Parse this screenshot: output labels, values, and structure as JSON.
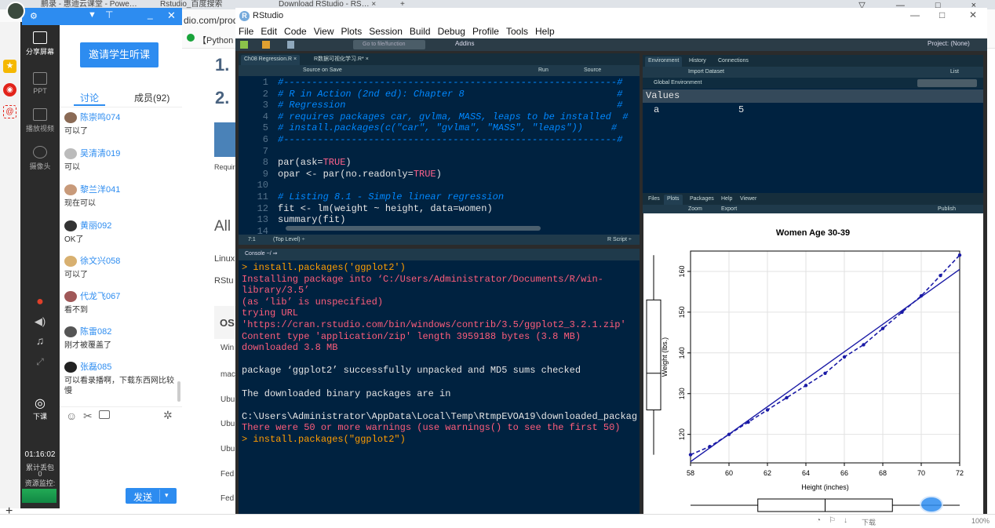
{
  "browser": {
    "tabs": [
      "鹏录 - 惠迪云课堂 - Powe…",
      "Rstudio_百度搜索",
      "Download RStudio - RS… ×",
      "+"
    ],
    "address_partial": "dio.com/prod",
    "bookmark": "【Python",
    "win_controls": "▽ — □ ×"
  },
  "webpage": {
    "heading1": "1.",
    "heading2": "2.",
    "requir": "Requir",
    "all": "All",
    "linux": "Linux",
    "rstud": "RStu",
    "os": "OS",
    "rows": [
      "Win",
      "mac",
      "Ubu",
      "Ubu",
      "Ubu",
      "Fed",
      "Fed"
    ]
  },
  "sidebar": {
    "share": "分享屏幕",
    "ppt": "PPT",
    "video": "播放视频",
    "camera": "摄像头",
    "end": "下课",
    "time": "01:16:02",
    "red_packet": "累计丢包",
    "red_count": "0",
    "monitor": "资源监控:"
  },
  "chat": {
    "invite_btn": "邀请学生听课",
    "tab_discuss": "讨论",
    "tab_members": "成员(92)",
    "messages": [
      {
        "name": "陈崇鸣074",
        "text": "可以了"
      },
      {
        "name": "吴清清019",
        "text": "可以"
      },
      {
        "name": "黎兰洋041",
        "text": "现在可以"
      },
      {
        "name": "黄丽092",
        "text": "OK了"
      },
      {
        "name": "徐文兴058",
        "text": "可以了"
      },
      {
        "name": "代龙飞067",
        "text": "看不到"
      },
      {
        "name": "陈雷082",
        "text": "刚才被覆盖了"
      },
      {
        "name": "张磊085",
        "text": "可以看录播啊，下载东西网比较慢"
      }
    ],
    "send": "发送",
    "send_arrow": "▾"
  },
  "rstudio": {
    "title": "RStudio",
    "menu": [
      "File",
      "Edit",
      "Code",
      "View",
      "Plots",
      "Session",
      "Build",
      "Debug",
      "Profile",
      "Tools",
      "Help"
    ],
    "go_to": "Go to file/function",
    "addins": "Addins",
    "project": "Project: (None)",
    "editor_tabs": [
      "Ch08 Regression.R ×",
      "R数据可视化学习.R* ×"
    ],
    "editor_tool": {
      "source_on_save": "Source on Save",
      "run": "Run",
      "source": "Source"
    },
    "code_lines": [
      {
        "n": "1",
        "t": "#-----------------------------------------------------------#",
        "c": "cm"
      },
      {
        "n": "2",
        "t": "# R in Action (2nd ed): Chapter 8                           #",
        "c": "cm"
      },
      {
        "n": "3",
        "t": "# Regression                                                #",
        "c": "cm"
      },
      {
        "n": "4",
        "t": "# requires packages car, gvlma, MASS, leaps to be installed  #",
        "c": "cm"
      },
      {
        "n": "5",
        "t": "# install.packages(c(\"car\", \"gvlma\", \"MASS\", \"leaps\"))     #",
        "c": "cm"
      },
      {
        "n": "6",
        "t": "#-----------------------------------------------------------#",
        "c": "cm"
      },
      {
        "n": "7",
        "t": "",
        "c": "tx"
      },
      {
        "n": "8",
        "t": "par(ask=TRUE)",
        "c": "tx"
      },
      {
        "n": "9",
        "t": "opar <- par(no.readonly=TRUE)",
        "c": "tx"
      },
      {
        "n": "10",
        "t": "",
        "c": "tx"
      },
      {
        "n": "11",
        "t": "# Listing 8.1 - Simple linear regression",
        "c": "cm"
      },
      {
        "n": "12",
        "t": "fit <- lm(weight ~ height, data=women)",
        "c": "tx"
      },
      {
        "n": "13",
        "t": "summary(fit)",
        "c": "tx"
      },
      {
        "n": "14",
        "t": "",
        "c": "tx"
      }
    ],
    "editor_status": {
      "pos": "7:1",
      "level": "(Top Level) ÷",
      "type": "R Script ÷"
    },
    "console_tab": "Console ~/ ⇒",
    "console_lines": [
      {
        "t": "> install.packages('ggplot2')",
        "c": "p"
      },
      {
        "t": "Installing package into ‘C:/Users/Administrator/Documents/R/win-library/3.5’",
        "c": "r"
      },
      {
        "t": "(as ‘lib’ is unspecified)",
        "c": "r"
      },
      {
        "t": "trying URL 'https://cran.rstudio.com/bin/windows/contrib/3.5/ggplot2_3.2.1.zip'",
        "c": "r"
      },
      {
        "t": "Content type 'application/zip' length 3959188 bytes (3.8 MB)",
        "c": "r"
      },
      {
        "t": "downloaded 3.8 MB",
        "c": "r"
      },
      {
        "t": " ",
        "c": ""
      },
      {
        "t": "package ‘ggplot2’ successfully unpacked and MD5 sums checked",
        "c": ""
      },
      {
        "t": " ",
        "c": ""
      },
      {
        "t": "The downloaded binary packages are in",
        "c": ""
      },
      {
        "t": "        C:\\Users\\Administrator\\AppData\\Local\\Temp\\RtmpEVOA19\\downloaded_packages",
        "c": ""
      },
      {
        "t": "There were 50 or more warnings (use warnings() to see the first 50)",
        "c": "r"
      },
      {
        "t": "> install.packages(\"ggplot2\")",
        "c": "p"
      }
    ],
    "env_tabs": [
      "Environment",
      "History",
      "Connections"
    ],
    "env_tool": {
      "import": "Import Dataset",
      "list": "List",
      "global": "Global Environment"
    },
    "env_section": "Values",
    "env_var": {
      "name": "a",
      "value": "5"
    },
    "files_tabs": [
      "Files",
      "Plots",
      "Packages",
      "Help",
      "Viewer"
    ],
    "plots_tool": {
      "zoom": "Zoom",
      "export": "Export",
      "publish": "Publish"
    }
  },
  "chart_data": {
    "type": "scatter",
    "title": "Women Age 30-39",
    "xlabel": "Height (inches)",
    "ylabel": "Weight (lbs.)",
    "xlim": [
      58,
      72
    ],
    "ylim": [
      113,
      165
    ],
    "xticks": [
      "58",
      "60",
      "62",
      "64",
      "66",
      "68",
      "70",
      "72"
    ],
    "yticks": [
      "120",
      "130",
      "140",
      "150",
      "160"
    ],
    "grid": true,
    "series": [
      {
        "x": [
          58,
          59,
          60,
          61,
          62,
          63,
          64,
          65,
          66,
          67,
          68,
          69,
          70,
          71,
          72
        ],
        "y": [
          115,
          117,
          120,
          123,
          126,
          129,
          132,
          135,
          139,
          142,
          146,
          150,
          154,
          159,
          164
        ]
      }
    ],
    "fit_line": {
      "x": [
        58,
        72
      ],
      "y": [
        113.3,
        160.5
      ]
    }
  },
  "status": {
    "zoom": "100%",
    "download": "下载"
  },
  "colors": {
    "accent": "#2d8cf0",
    "editor_bg": "#002240",
    "comment": "#0088ff",
    "error": "#ff5d7b"
  }
}
